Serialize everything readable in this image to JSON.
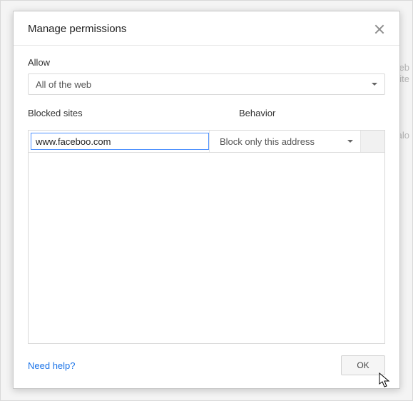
{
  "dialog": {
    "title": "Manage permissions",
    "allow": {
      "label": "Allow",
      "selected": "All of the web"
    },
    "columns": {
      "blocked_sites": "Blocked sites",
      "behavior": "Behavior"
    },
    "entry": {
      "site_value": "www.faceboo.com",
      "behavior_selected": "Block only this address"
    },
    "footer": {
      "help": "Need help?",
      "ok": "OK"
    }
  }
}
